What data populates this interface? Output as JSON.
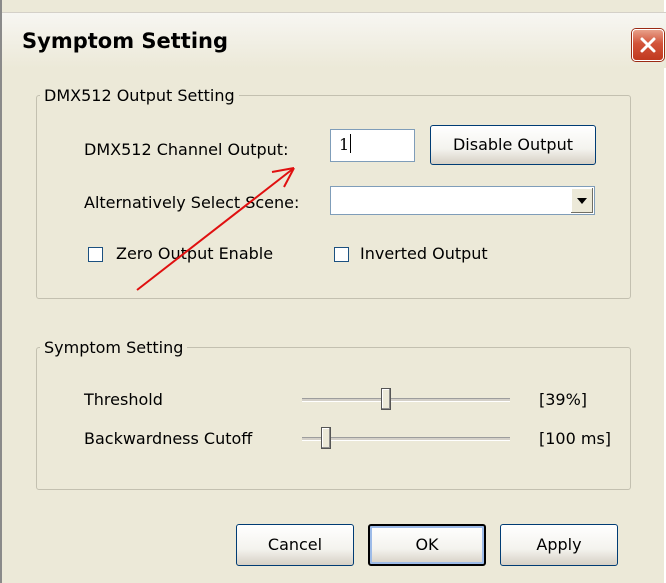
{
  "window": {
    "title": "Symptom Setting",
    "close_icon": "close-icon",
    "accent_color": "#c1391f"
  },
  "dmx_group": {
    "label": "DMX512 Output Setting",
    "channel_label": "DMX512 Channel Output:",
    "channel_value": "1",
    "disable_button": "Disable Output",
    "scene_label": "Alternatively Select Scene:",
    "scene_value": "",
    "zero_output_label": "Zero Output Enable",
    "zero_output_checked": false,
    "inverted_label": "Inverted Output",
    "inverted_checked": false
  },
  "symptom_group": {
    "label": "Symptom Setting",
    "threshold_label": "Threshold",
    "threshold_value": "[39%]",
    "threshold_level": 0.39,
    "cutoff_label": "Backwardness Cutoff",
    "cutoff_value": "[100 ms]",
    "cutoff_level": 0.12
  },
  "buttons": {
    "cancel": "Cancel",
    "ok": "OK",
    "apply": "Apply"
  },
  "annotation": {
    "arrow_color": "#e01010"
  }
}
